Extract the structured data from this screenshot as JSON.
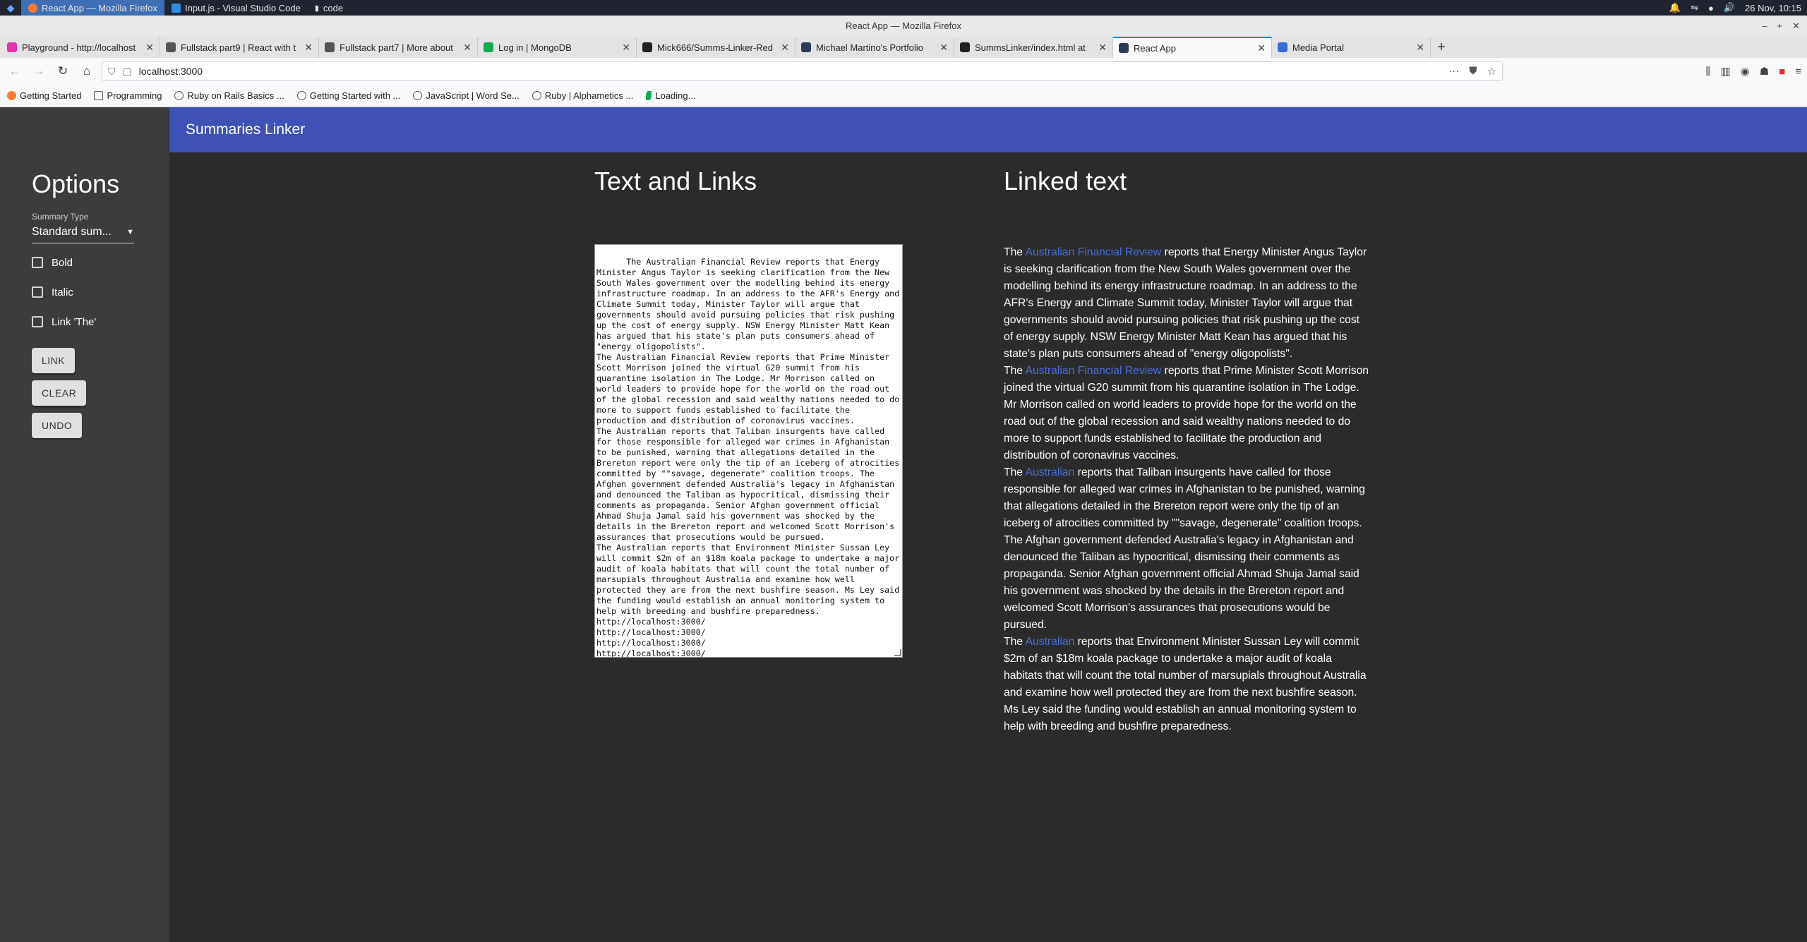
{
  "taskbar": {
    "tasks": [
      {
        "label": "React App — Mozilla Firefox",
        "active": true
      },
      {
        "label": "Input.js - Visual Studio Code",
        "active": false
      },
      {
        "label": "code",
        "active": false
      }
    ],
    "clock": "26 Nov, 10:15"
  },
  "window": {
    "title": "React App — Mozilla Firefox"
  },
  "tabs": [
    {
      "label": "Playground - http://localhost",
      "favicon_color": "#e535ab"
    },
    {
      "label": "Fullstack part9 | React with t",
      "favicon_color": "#555555"
    },
    {
      "label": "Fullstack part7 | More about",
      "favicon_color": "#555555"
    },
    {
      "label": "Log in | MongoDB",
      "favicon_color": "#13aa52"
    },
    {
      "label": "Mick666/Summs-Linker-Red",
      "favicon_color": "#222222"
    },
    {
      "label": "Michael Martino's Portfolio",
      "favicon_color": "#2b3a55"
    },
    {
      "label": "SummsLinker/index.html at",
      "favicon_color": "#222222"
    },
    {
      "label": "React App",
      "favicon_color": "#2b3a55",
      "active": true
    },
    {
      "label": "Media Portal",
      "favicon_color": "#3a6ad6"
    }
  ],
  "address_bar": {
    "url": "localhost:3000"
  },
  "bookmarks": [
    {
      "label": "Getting Started",
      "icon": "firefox-icon"
    },
    {
      "label": "Programming",
      "icon": "folder-icon"
    },
    {
      "label": "Ruby on Rails Basics ...",
      "icon": "globe-icon"
    },
    {
      "label": "Getting Started with ...",
      "icon": "globe-icon"
    },
    {
      "label": "JavaScript | Word Se...",
      "icon": "globe-icon"
    },
    {
      "label": "Ruby | Alphametics ...",
      "icon": "globe-icon"
    },
    {
      "label": "Loading...",
      "icon": "leaf-icon"
    }
  ],
  "app": {
    "title": "Summaries Linker",
    "accent": "#3f51b5"
  },
  "options": {
    "heading": "Options",
    "summary_type_label": "Summary Type",
    "summary_type_value": "Standard sum...",
    "checkboxes": [
      {
        "label": "Bold",
        "checked": false
      },
      {
        "label": "Italic",
        "checked": false
      },
      {
        "label": "Link 'The'",
        "checked": false
      }
    ],
    "buttons": {
      "link": "LINK",
      "clear": "CLEAR",
      "undo": "UNDO"
    }
  },
  "text_and_links": {
    "heading": "Text and Links",
    "content": "The Australian Financial Review reports that Energy Minister Angus Taylor is seeking clarification from the New South Wales government over the modelling behind its energy infrastructure roadmap. In an address to the AFR's Energy and Climate Summit today, Minister Taylor will argue that governments should avoid pursuing policies that risk pushing up the cost of energy supply. NSW Energy Minister Matt Kean has argued that his state's plan puts consumers ahead of \"energy oligopolists\".\nThe Australian Financial Review reports that Prime Minister Scott Morrison joined the virtual G20 summit from his quarantine isolation in The Lodge. Mr Morrison called on world leaders to provide hope for the world on the road out of the global recession and said wealthy nations needed to do more to support funds established to facilitate the production and distribution of coronavirus vaccines.\nThe Australian reports that Taliban insurgents have called for those responsible for alleged war crimes in Afghanistan to be punished, warning that allegations detailed in the Brereton report were only the tip of an iceberg of atrocities committed by \"\"savage, degenerate\" coalition troops. The Afghan government defended Australia's legacy in Afghanistan and denounced the Taliban as hypocritical, dismissing their comments as propaganda. Senior Afghan government official Ahmad Shuja Jamal said his government was shocked by the details in the Brereton report and welcomed Scott Morrison's assurances that prosecutions would be pursued.\nThe Australian reports that Environment Minister Sussan Ley will commit $2m of an $18m koala package to undertake a major audit of koala habitats that will count the total number of marsupials throughout Australia and examine how well protected they are from the next bushfire season. Ms Ley said the funding would establish an annual monitoring system to help with breeding and bushfire preparedness.\nhttp://localhost:3000/\nhttp://localhost:3000/\nhttp://localhost:3000/\nhttp://localhost:3000/"
  },
  "linked_text": {
    "heading": "Linked text",
    "link_color": "#4a6fd8",
    "paragraphs": [
      {
        "prefix": "The ",
        "source": "Australian Financial Review",
        "rest": " reports that Energy Minister Angus Taylor is seeking clarification from the New South Wales government over the modelling behind its energy infrastructure roadmap. In an address to the AFR's Energy and Climate Summit today, Minister Taylor will argue that governments should avoid pursuing policies that risk pushing up the cost of energy supply. NSW Energy Minister Matt Kean has argued that his state's plan puts consumers ahead of \"energy oligopolists\"."
      },
      {
        "prefix": "The ",
        "source": "Australian Financial Review",
        "rest": " reports that Prime Minister Scott Morrison joined the virtual G20 summit from his quarantine isolation in The Lodge. Mr Morrison called on world leaders to provide hope for the world on the road out of the global recession and said wealthy nations needed to do more to support funds established to facilitate the production and distribution of coronavirus vaccines."
      },
      {
        "prefix": "The ",
        "source": "Australian",
        "rest": " reports that Taliban insurgents have called for those responsible for alleged war crimes in Afghanistan to be punished, warning that allegations detailed in the Brereton report were only the tip of an iceberg of atrocities committed by \"\"savage, degenerate\" coalition troops. The Afghan government defended Australia's legacy in Afghanistan and denounced the Taliban as hypocritical, dismissing their comments as propaganda. Senior Afghan government official Ahmad Shuja Jamal said his government was shocked by the details in the Brereton report and welcomed Scott Morrison's assurances that prosecutions would be pursued."
      },
      {
        "prefix": "The ",
        "source": "Australian",
        "rest": " reports that Environment Minister Sussan Ley will commit $2m of an $18m koala package to undertake a major audit of koala habitats that will count the total number of marsupials throughout Australia and examine how well protected they are from the next bushfire season. Ms Ley said the funding would establish an annual monitoring system to help with breeding and bushfire preparedness."
      }
    ]
  }
}
